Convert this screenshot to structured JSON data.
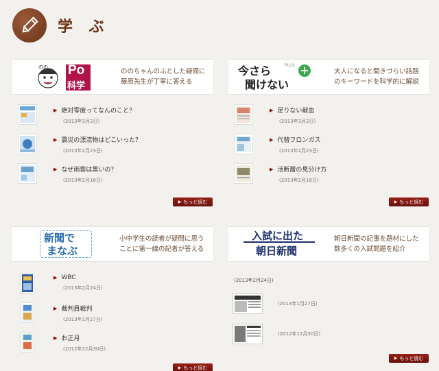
{
  "header": {
    "title": "学 ぶ",
    "icon": "pencil-icon"
  },
  "panels": {
    "po": {
      "logo_main": "Po",
      "logo_sub": "科学",
      "tagline": [
        "ののちゃんのふとした疑問に",
        "藤原先生が丁寧に答える"
      ],
      "items": [
        {
          "title": "絶対零度ってなんのこと？",
          "date": "(2013年3月2日)"
        },
        {
          "title": "震災の漂流物はどこいった？",
          "date": "(2013年2月23日)"
        },
        {
          "title": "なぜ雨雲は黒いの？",
          "date": "(2013年2月16日)"
        }
      ],
      "more": "もっと読む"
    },
    "imasara": {
      "logo_line1": "今さら",
      "logo_line2": "聞けない",
      "logo_plus": "PLUS",
      "tagline": [
        "大人になると聞きづらい話題",
        "のキーワードを科学的に解説"
      ],
      "items": [
        {
          "title": "足りない献血",
          "date": "(2013年3月2日)"
        },
        {
          "title": "代替フロンガス",
          "date": "(2013年2月23日)"
        },
        {
          "title": "活断層の見分け方",
          "date": "(2013年2月16日)"
        }
      ],
      "more": "もっと読む"
    },
    "shinbun": {
      "logo_line1": "新聞で",
      "logo_line2": "まなぶ",
      "tagline": [
        "小中学生の読者が疑問に思う",
        "ことに第一線の記者が答える"
      ],
      "items": [
        {
          "title": "WBC",
          "date": "(2013年2月24日)"
        },
        {
          "title": "裁判員裁判",
          "date": "(2013年1月27日)"
        },
        {
          "title": "お正月",
          "date": "(2012年12月30日)"
        }
      ],
      "more": "もっと読む"
    },
    "nyushi": {
      "logo_line1": "入試に出た",
      "logo_line2": "朝日新聞",
      "tagline": [
        "朝日新聞の記事を題材にした",
        "数多くの入試問題を紹介"
      ],
      "top_date": "(2013年2月24日)",
      "items": [
        {
          "date": "(2013年1月27日)"
        },
        {
          "date": "(2012年12月30日)"
        }
      ],
      "more": "もっと読む"
    }
  }
}
